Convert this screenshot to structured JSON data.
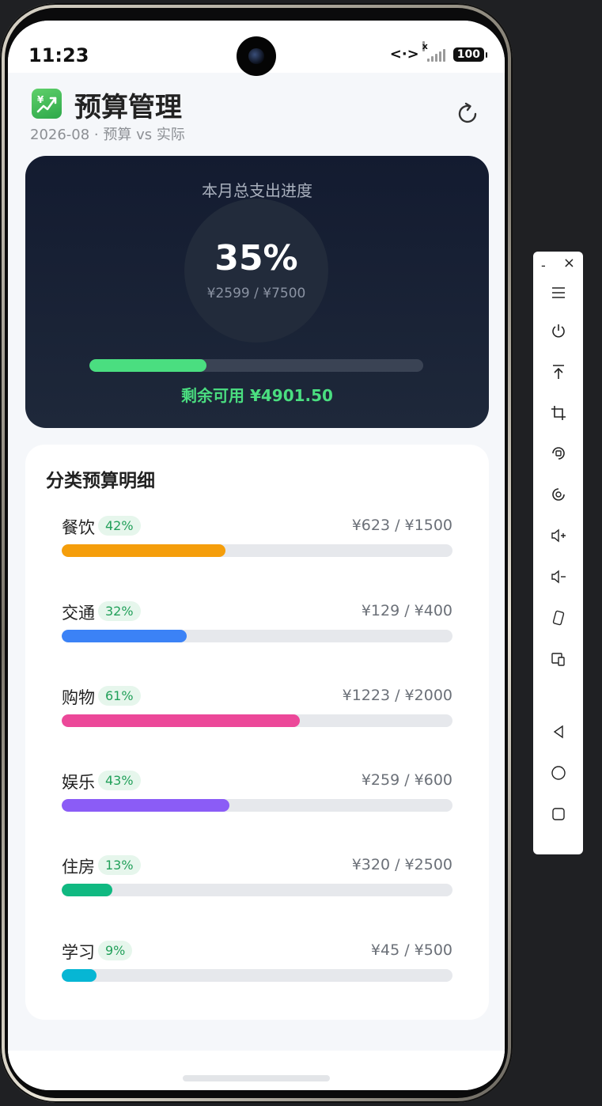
{
  "status_bar": {
    "time": "11:23",
    "hotspot": "<·>",
    "signal_x": "x",
    "battery": "100"
  },
  "header": {
    "title": "预算管理",
    "subtitle": "2026-08 · 预算 vs 实际",
    "icon": "chart-up-icon",
    "refresh_icon": "refresh-icon"
  },
  "summary": {
    "title": "本月总支出进度",
    "percent_label": "35%",
    "progress": 0.35,
    "amount": "¥2599 / ¥7500",
    "remaining": "剩余可用 ¥4901.50",
    "accent": "#4ade80"
  },
  "categories_section": {
    "title": "分类预算明细",
    "items": [
      {
        "name": "餐饮",
        "pct": "42%",
        "progress": 0.42,
        "amount": "¥623 / ¥1500",
        "color": "#f59e0b"
      },
      {
        "name": "交通",
        "pct": "32%",
        "progress": 0.32,
        "amount": "¥129 / ¥400",
        "color": "#3b82f6"
      },
      {
        "name": "购物",
        "pct": "61%",
        "progress": 0.61,
        "amount": "¥1223 / ¥2000",
        "color": "#ec4899"
      },
      {
        "name": "娱乐",
        "pct": "43%",
        "progress": 0.43,
        "amount": "¥259 / ¥600",
        "color": "#8b5cf6"
      },
      {
        "name": "住房",
        "pct": "13%",
        "progress": 0.13,
        "amount": "¥320 / ¥2500",
        "color": "#10b981"
      },
      {
        "name": "学习",
        "pct": "9%",
        "progress": 0.09,
        "amount": "¥45 / ¥500",
        "color": "#06b6d4"
      }
    ]
  },
  "emulator_toolbar": {
    "minimize": "-",
    "close": "×",
    "buttons": [
      "menu-icon",
      "power-icon",
      "pin-top-icon",
      "crop-icon",
      "rotate-lock-icon",
      "screenshot-icon",
      "volume-up-icon",
      "volume-down-icon",
      "rotate-icon",
      "multi-device-icon",
      "back-icon",
      "home-icon",
      "recents-icon"
    ]
  }
}
